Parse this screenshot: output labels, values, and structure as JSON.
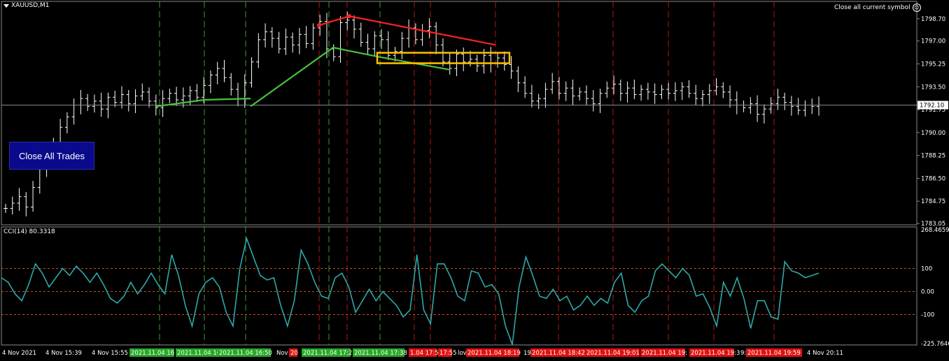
{
  "header": {
    "symbol_label": "XAUUSD,M1",
    "close_symbol_label": "Close all current symbol",
    "close_symbol_icon": "smiley-icon"
  },
  "buttons": {
    "close_all_trades": "Close All Trades"
  },
  "colors": {
    "background": "#000000",
    "candles": "#ffffff",
    "green_vline": "#3c9a2e",
    "red_vline": "#b01818",
    "trend_red": "#ff2020",
    "trend_green": "#46c23c",
    "box": "#ffc000",
    "cci_line": "#2ea8a8",
    "cci_level": "#d04a1e",
    "time_label_green": "#27a827",
    "time_label_red": "#e01010"
  },
  "chart_data": [
    {
      "type": "candlestick",
      "title": "XAUUSD,M1",
      "ylim": [
        1783.05,
        1799.6
      ],
      "y_ticks": [
        "1798.70",
        "1797.00",
        "1795.25",
        "1793.50",
        "1791.75",
        "1790.00",
        "1788.25",
        "1786.50",
        "1784.75",
        "1783.05"
      ],
      "current_price": "1792.10",
      "close_series": [
        1784.2,
        1784.6,
        1785.1,
        1784.3,
        1785.8,
        1787.2,
        1788.3,
        1789.1,
        1790.4,
        1791.2,
        1792.1,
        1792.6,
        1792.0,
        1792.4,
        1791.8,
        1792.7,
        1792.3,
        1792.9,
        1792.2,
        1792.8,
        1793.1,
        1792.4,
        1791.9,
        1792.6,
        1793.0,
        1792.5,
        1792.8,
        1793.2,
        1792.7,
        1793.6,
        1794.4,
        1794.9,
        1794.2,
        1793.3,
        1792.6,
        1793.8,
        1795.4,
        1797.1,
        1797.7,
        1797.2,
        1796.4,
        1797.3,
        1796.7,
        1797.5,
        1796.8,
        1798.0,
        1798.5,
        1796.4,
        1795.8,
        1798.4,
        1798.6,
        1797.9,
        1796.9,
        1796.4,
        1797.4,
        1797.1,
        1795.9,
        1796.2,
        1797.2,
        1798.0,
        1797.1,
        1797.8,
        1798.1,
        1796.7,
        1795.4,
        1794.9,
        1796.0,
        1795.4,
        1795.6,
        1795.1,
        1795.9,
        1795.3,
        1795.7,
        1795.2,
        1794.7,
        1793.8,
        1793.0,
        1792.4,
        1792.6,
        1793.3,
        1793.9,
        1793.0,
        1793.4,
        1792.8,
        1793.1,
        1792.6,
        1792.2,
        1793.0,
        1793.4,
        1793.7,
        1793.0,
        1793.4,
        1792.9,
        1793.3,
        1793.1,
        1792.9,
        1793.3,
        1793.0,
        1793.2,
        1793.5,
        1793.0,
        1792.6,
        1792.9,
        1793.2,
        1793.5,
        1793.1,
        1792.5,
        1792.1,
        1791.9,
        1792.2,
        1791.4,
        1791.8,
        1792.2,
        1792.7,
        1792.3,
        1792.0,
        1791.7,
        1792.1,
        1792.0,
        1792.1
      ],
      "trendlines": [
        {
          "color": "red",
          "points": [
            [
              2021.11041724,
              1798.2
            ],
            [
              2021.1104173,
              1798.9
            ],
            [
              2021.11041801,
              1796.7
            ]
          ]
        },
        {
          "color": "green",
          "points": [
            [
              2021.11041602,
              1792.0
            ],
            [
              2021.11041631,
              1792.5
            ]
          ]
        },
        {
          "color": "green",
          "points": [
            [
              2021.11041652,
              1792.0
            ],
            [
              2021.11041725,
              1796.5
            ],
            [
              2021.11041751,
              1795.1
            ]
          ]
        }
      ],
      "box_range": [
        1795.3,
        1796.1
      ]
    },
    {
      "type": "line",
      "title": "CCI(14) 80.3318",
      "ylim": [
        -225.7646,
        268.4659
      ],
      "y_ticks": [
        "268.4659",
        "100",
        "0.00",
        "-100",
        "-225.7646"
      ],
      "levels": [
        100,
        0,
        -100
      ],
      "series": [
        {
          "name": "CCI(14)",
          "values": [
            60,
            40,
            -10,
            -40,
            30,
            120,
            80,
            20,
            60,
            100,
            70,
            110,
            80,
            40,
            80,
            30,
            -30,
            -50,
            -20,
            40,
            -10,
            30,
            80,
            30,
            -10,
            160,
            70,
            -60,
            -150,
            -10,
            40,
            60,
            20,
            -90,
            -150,
            100,
            230,
            150,
            70,
            50,
            60,
            -60,
            -150,
            -40,
            180,
            120,
            40,
            -20,
            -30,
            60,
            80,
            20,
            -90,
            -40,
            10,
            -40,
            0,
            -30,
            -60,
            -110,
            -80,
            160,
            -80,
            -140,
            120,
            120,
            60,
            -20,
            -40,
            90,
            80,
            20,
            30,
            -10,
            -150,
            -230,
            20,
            150,
            70,
            -20,
            -30,
            10,
            -40,
            -20,
            -80,
            -60,
            -20,
            -60,
            -30,
            -50,
            40,
            80,
            -60,
            -90,
            -40,
            -20,
            90,
            120,
            90,
            60,
            100,
            70,
            -20,
            -10,
            -70,
            -150,
            40,
            -20,
            60,
            -30,
            -160,
            -40,
            -40,
            -110,
            -120,
            130,
            90,
            80,
            60,
            70,
            80
          ]
        }
      ],
      "time_labels": [
        "4 Nov 2021",
        "4 Nov 15:39",
        "4 Nov 15:55",
        "2021.11.04 16",
        "2021.11.04 16",
        "2021.11.04 16:50",
        "Nov",
        "20",
        "2021.11.04 17:2",
        "2021.11.04 17:38",
        "1.04 17:50",
        "17:55",
        "lov",
        "2021.11.04 18:19",
        "19",
        "2021.11.04 18:42",
        "2021.11.04 19:01",
        "2021.11.04 19:",
        "2021.11.04 19:3",
        "9:",
        "2021.11.04 19:59",
        "4 Nov 20:11"
      ]
    }
  ]
}
